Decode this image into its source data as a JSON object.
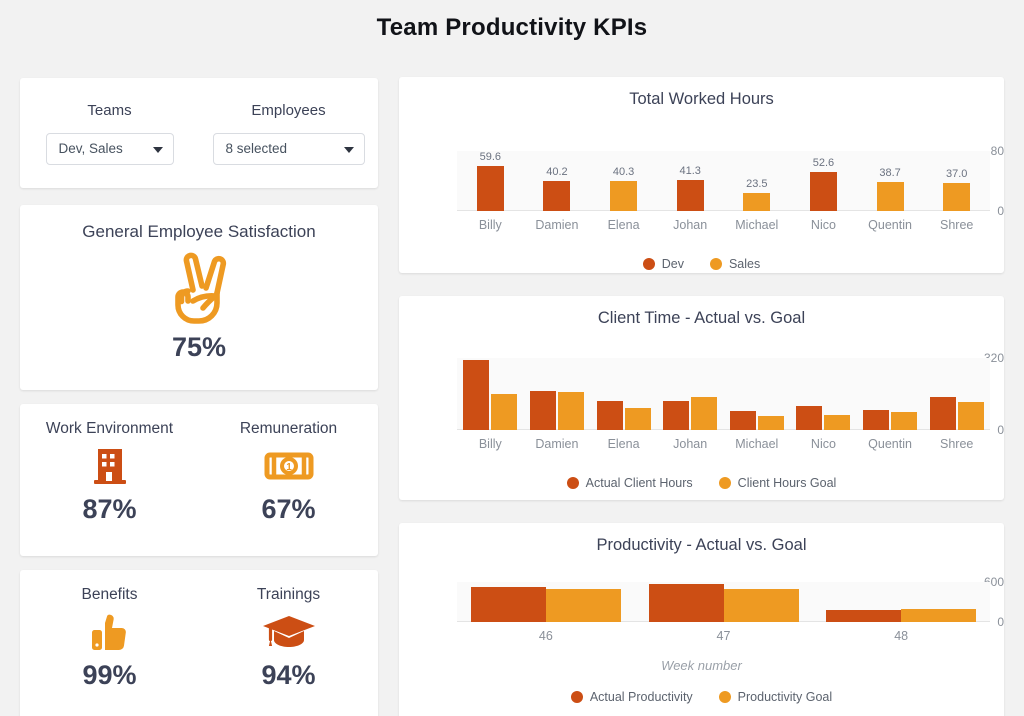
{
  "title": "Team Productivity KPIs",
  "colors": {
    "dev": "#cc4e14",
    "sales": "#ee9a22",
    "text": "#3c4257"
  },
  "filters": {
    "teams": {
      "label": "Teams",
      "value": "Dev, Sales"
    },
    "employees": {
      "label": "Employees",
      "value": "8 selected"
    }
  },
  "kpis": {
    "satisfaction": {
      "label": "General Employee Satisfaction",
      "value": "75%",
      "icon": "peace-hand-icon"
    },
    "work_environment": {
      "label": "Work Environment",
      "value": "87%",
      "icon": "office-building-icon"
    },
    "remuneration": {
      "label": "Remuneration",
      "value": "67%",
      "icon": "banknote-icon"
    },
    "benefits": {
      "label": "Benefits",
      "value": "99%",
      "icon": "thumbs-up-icon"
    },
    "trainings": {
      "label": "Trainings",
      "value": "94%",
      "icon": "graduation-cap-icon"
    }
  },
  "chart_data": [
    {
      "id": "total-worked-hours",
      "type": "bar",
      "title": "Total Worked Hours",
      "xlabel": "",
      "ylabel": "",
      "ylim": [
        0,
        80
      ],
      "yticks": [
        "0",
        "80"
      ],
      "grid": false,
      "legend_position": "bottom",
      "categories": [
        "Billy",
        "Damien",
        "Elena",
        "Johan",
        "Michael",
        "Nico",
        "Quentin",
        "Shree"
      ],
      "values": [
        59.6,
        40.2,
        40.3,
        41.3,
        23.5,
        52.6,
        38.7,
        37.0
      ],
      "labels": [
        "59.6",
        "40.2",
        "40.3",
        "41.3",
        "23.5",
        "52.6",
        "38.7",
        "37.0"
      ],
      "groups": [
        "Dev",
        "Dev",
        "Sales",
        "Dev",
        "Sales",
        "Dev",
        "Sales",
        "Sales"
      ],
      "legend": [
        {
          "name": "Dev",
          "color": "#cc4e14"
        },
        {
          "name": "Sales",
          "color": "#ee9a22"
        }
      ]
    },
    {
      "id": "client-time-actual-vs-goal",
      "type": "bar",
      "title": "Client Time - Actual vs. Goal",
      "xlabel": "",
      "ylabel": "",
      "ylim": [
        0,
        320
      ],
      "yticks": [
        "0",
        "320"
      ],
      "grid": false,
      "legend_position": "bottom",
      "categories": [
        "Billy",
        "Damien",
        "Elena",
        "Johan",
        "Michael",
        "Nico",
        "Quentin",
        "Shree"
      ],
      "series": [
        {
          "name": "Actual Client Hours",
          "color": "#cc4e14",
          "values": [
            310,
            172,
            130,
            128,
            85,
            108,
            87,
            148
          ]
        },
        {
          "name": "Client Hours Goal",
          "color": "#ee9a22",
          "values": [
            160,
            168,
            100,
            145,
            62,
            65,
            80,
            125
          ]
        }
      ],
      "legend": [
        {
          "name": "Actual Client Hours",
          "color": "#cc4e14"
        },
        {
          "name": "Client Hours Goal",
          "color": "#ee9a22"
        }
      ]
    },
    {
      "id": "productivity-actual-vs-goal",
      "type": "bar",
      "title": "Productivity - Actual vs. Goal",
      "xlabel": "Week number",
      "ylabel": "",
      "ylim": [
        0,
        600
      ],
      "yticks": [
        "0",
        "600"
      ],
      "grid": false,
      "legend_position": "bottom",
      "categories": [
        "46",
        "47",
        "48"
      ],
      "series": [
        {
          "name": "Actual Productivity",
          "color": "#cc4e14",
          "values": [
            530,
            565,
            180
          ]
        },
        {
          "name": "Productivity Goal",
          "color": "#ee9a22",
          "values": [
            490,
            490,
            200
          ]
        }
      ],
      "legend": [
        {
          "name": "Actual Productivity",
          "color": "#cc4e14"
        },
        {
          "name": "Productivity Goal",
          "color": "#ee9a22"
        }
      ]
    }
  ]
}
